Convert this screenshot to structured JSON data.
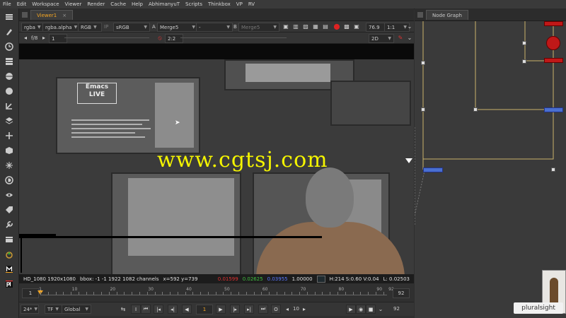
{
  "menu": [
    "File",
    "Edit",
    "Workspace",
    "Viewer",
    "Render",
    "Cache",
    "Help",
    "AbhimanyuT",
    "Scripts",
    "Thinkbox",
    "VP",
    "RV"
  ],
  "viewer": {
    "tab_title": "Viewer1",
    "tab_close": "×",
    "controls": {
      "channels": "rgba",
      "alpha": "rgba.alpha",
      "colorspace": "RGB",
      "ip": "IP",
      "lut": "sRGB",
      "a_label": "A",
      "a_input": "Merge5",
      "a_op": "-",
      "b_label": "B",
      "b_input": "Merge5",
      "gain": "76.9",
      "zoom": "1:1"
    },
    "controls2": {
      "fstop": "f/8",
      "frame": "1",
      "proxy": "2:2",
      "view_mode": "2D",
      "ruler_value": "1"
    },
    "image": {
      "emacs_line1": "Emacs",
      "emacs_line2": "LIVE",
      "watermark": "www.cgtsj.com"
    },
    "info": {
      "format": "HD_1080 1920x1080",
      "bbox": "bbox: -1 -1 1922 1082 channels",
      "coords": "x=592 y=739",
      "r": "0.01599",
      "g": "0.02625",
      "b": "0.03955",
      "a": "1.00000",
      "hsv": "H:214 S:0.60 V:0.04",
      "luma": "L: 0.02503"
    },
    "timeline": {
      "start": "1",
      "end": "92",
      "ticks": [
        "1",
        "10",
        "20",
        "30",
        "40",
        "50",
        "60",
        "70",
        "80",
        "90",
        "92"
      ],
      "fps": "24*",
      "tf": "TF",
      "global": "Global",
      "current": "1",
      "step": "10",
      "last": "92",
      "playhead_frame": 1
    }
  },
  "node_graph": {
    "tab_title": "Node Graph"
  },
  "brand": {
    "pluralsight": "pluralsight"
  },
  "colors": {
    "accent": "#f5a623",
    "watermark": "#f4f400",
    "node_blue": "#4a6fd0",
    "node_red": "#c01818"
  }
}
